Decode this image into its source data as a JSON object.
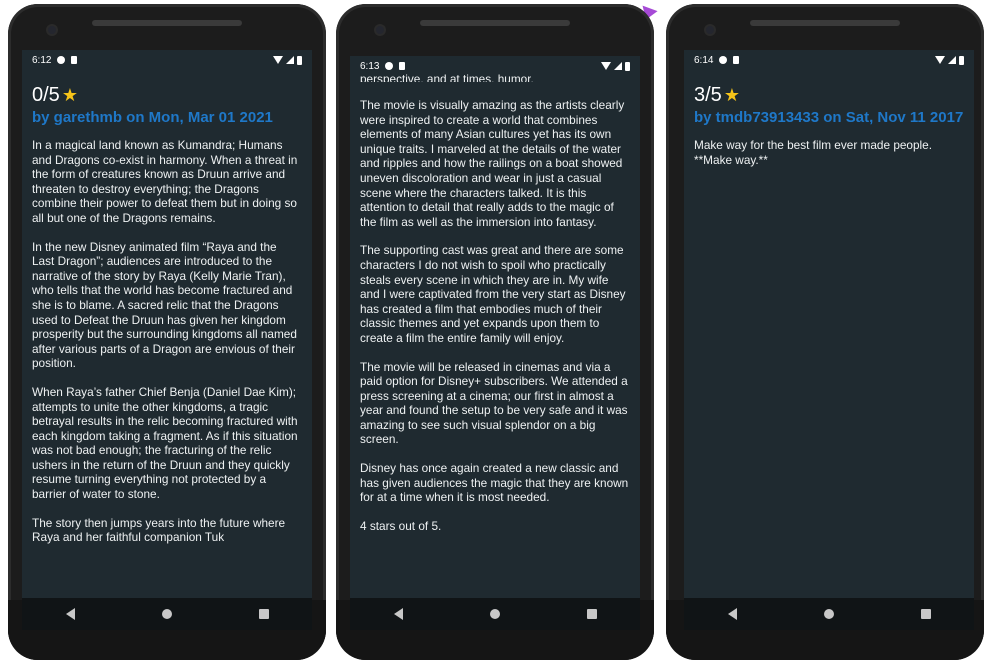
{
  "phones": [
    {
      "time": "6:12",
      "rating": "0/5",
      "star": "★",
      "author_line": "by garethmb on Mon, Mar 01 2021",
      "paragraphs": [
        "In a magical land known as Kumandra; Humans and Dragons co-exist in harmony. When a threat in the form of creatures known as Druun arrive and threaten to destroy everything; the Dragons combine their power to defeat them but in doing so all but one of the Dragons remains.",
        "In the new Disney animated film “Raya and the Last Dragon”; audiences are introduced to the narrative of the story by Raya (Kelly Marie Tran), who tells that the world has become fractured and she is to blame. A sacred relic that the Dragons used to Defeat the Druun has given her kingdom prosperity but the surrounding kingdoms all named after various parts of a Dragon are envious of their position.",
        "When Raya’s father Chief Benja (Daniel Dae Kim); attempts to unite the other kingdoms, a tragic betrayal results in the relic becoming fractured with each kingdom taking a fragment. As if this situation was not bad enough; the fracturing of the relic ushers in the return of the Druun and they quickly resume turning everything not protected by a barrier of water to stone.",
        "The story then jumps years into the future where Raya and her faithful companion Tuk"
      ]
    },
    {
      "time": "6:13",
      "top_partial": "perspective, and at times, humor.",
      "paragraphs": [
        "The movie is visually amazing as the artists clearly were inspired to create a world that combines elements of many Asian cultures yet has its own unique traits. I marveled at the details of the water and ripples and how the railings on a boat showed uneven discoloration and wear in just a casual scene where the characters talked. It is this attention to detail that really adds to the magic of the film as well as the immersion into fantasy.",
        "The supporting cast was great and there are some characters I do not wish to spoil who practically steals every scene in which they are in.  My wife and I were captivated from the very start as Disney has created a film that embodies much of their classic themes and yet expands upon them to create a film the entire family will enjoy.",
        "The movie will be released in cinemas and via a paid option for Disney+ subscribers. We attended a press screening at a cinema; our first in almost a year and found the setup to be very safe and it was amazing to see such visual splendor on a big screen.",
        "Disney has once again created a new classic and has given audiences the magic that they are known for at a time when it is most needed.",
        "4 stars out of 5."
      ]
    },
    {
      "time": "6:14",
      "rating": "3/5",
      "star": "★",
      "author_line": "by tmdb73913433 on Sat, Nov 11 2017",
      "paragraphs": [
        "Make way for the best film ever made people. **Make way.**"
      ]
    }
  ],
  "colors": {
    "screen_bg": "#1f2a30",
    "author": "#1f78c8",
    "star": "#f6c419"
  },
  "icons": {
    "nav": [
      "back-icon",
      "home-icon",
      "recents-icon"
    ],
    "status": [
      "wifi-icon",
      "signal-icon",
      "battery-icon"
    ]
  }
}
